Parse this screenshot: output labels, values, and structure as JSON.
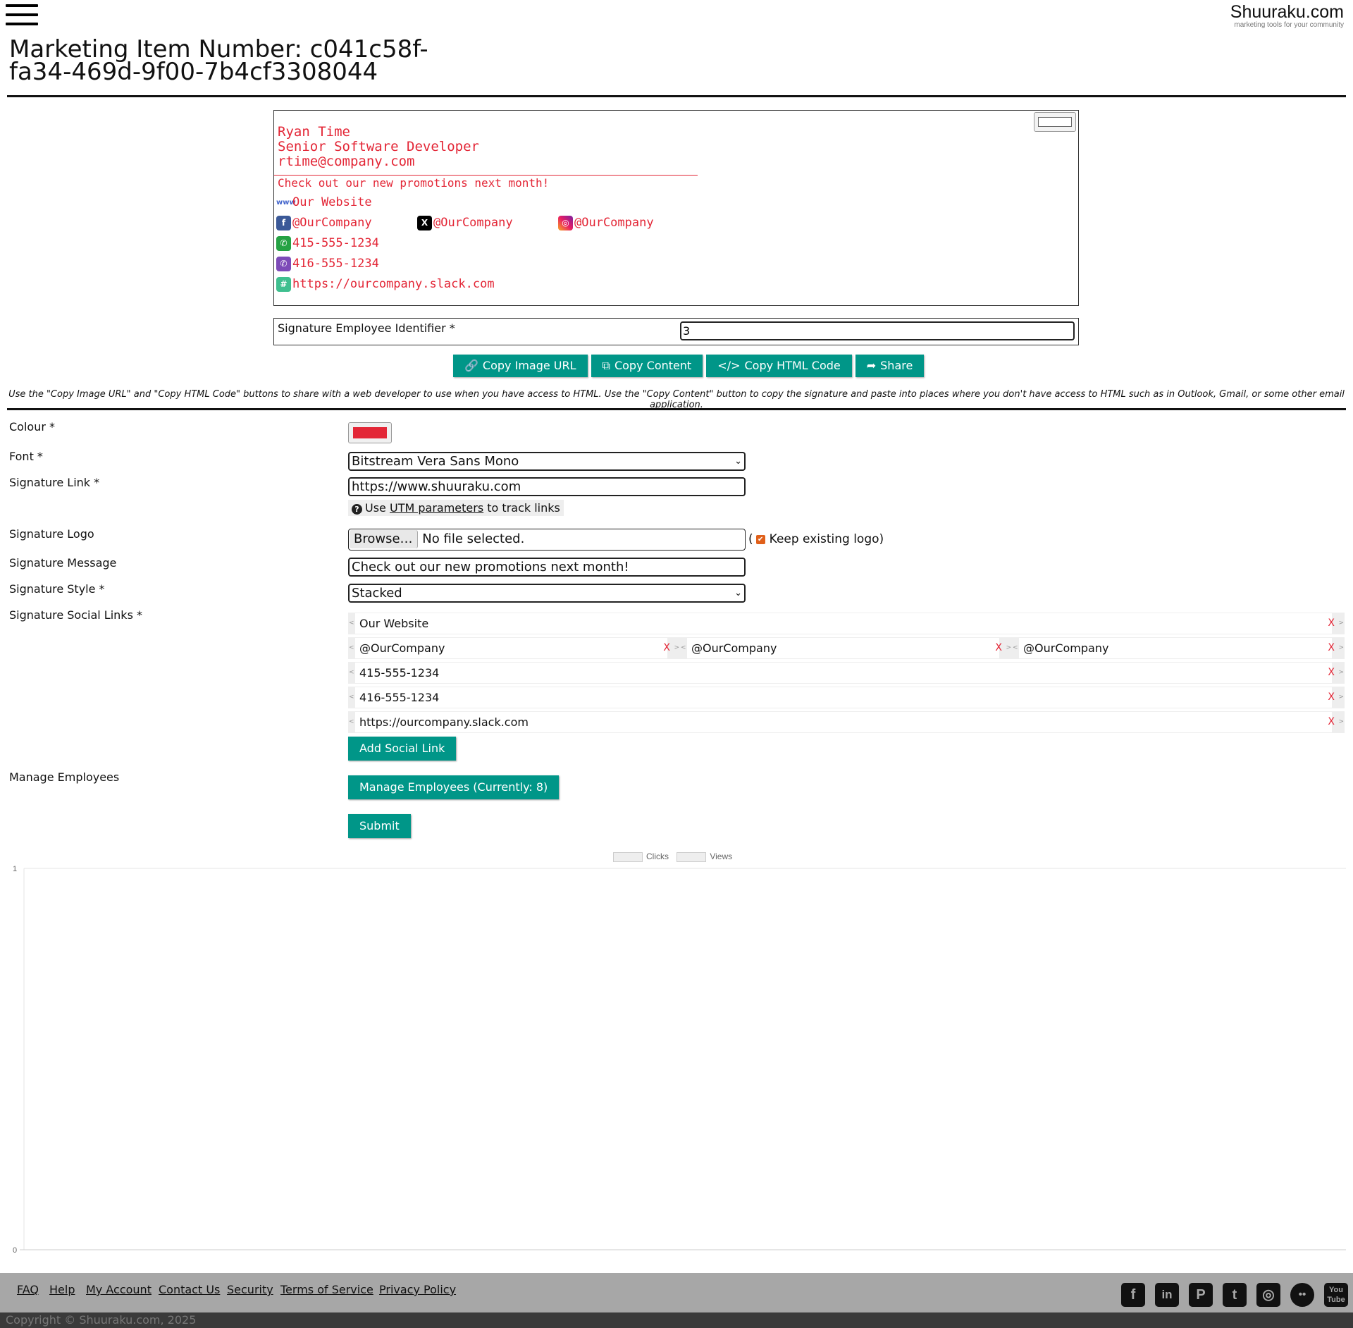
{
  "header": {
    "brand_name": "Shuuraku.com",
    "brand_tagline": "marketing tools for your community",
    "title": "Marketing Item Number: c041c58f-fa34-469d-9f00-7b4cf3308044"
  },
  "signature_preview": {
    "name": "Ryan Time",
    "job_title": "Senior Software Developer",
    "email": "rtime@company.com",
    "message": "Check out our new promotions next month!",
    "website": "Our Website",
    "facebook": "@OurCompany",
    "x": "@OurCompany",
    "instagram": "@OurCompany",
    "whatsapp": "415-555-1234",
    "viber": "416-555-1234",
    "slack": "https://ourcompany.slack.com",
    "color": "#e32636",
    "icons": {
      "www": "globe-icon",
      "facebook": "facebook-icon",
      "x": "x-icon",
      "instagram": "instagram-icon",
      "whatsapp": "whatsapp-icon",
      "viber": "viber-icon",
      "slack": "slack-icon"
    }
  },
  "identifier": {
    "label": "Signature Employee Identifier *",
    "value": "3"
  },
  "actions": {
    "copy_image_url": "Copy Image URL",
    "copy_content": "Copy Content",
    "copy_html_code": "Copy HTML Code",
    "share": "Share",
    "hint": "Use the \"Copy Image URL\" and \"Copy HTML Code\" buttons to share with a web developer to use when you have access to HTML. Use the \"Copy Content\" button to copy the signature and paste into places where you don't have access to HTML such as in Outlook, Gmail, or some other email application."
  },
  "form": {
    "colour_label": "Colour *",
    "colour_value": "#e32636",
    "font_label": "Font *",
    "font_value": "Bitstream Vera Sans Mono",
    "link_label": "Signature Link *",
    "link_value": "https://www.shuuraku.com",
    "utm_pre": "Use",
    "utm_link": "UTM parameters",
    "utm_post": "to track links",
    "logo_label": "Signature Logo",
    "browse": "Browse…",
    "no_file": "No file selected.",
    "keep_logo": "Keep existing logo)",
    "keep_open": "(",
    "message_label": "Signature Message",
    "message_value": "Check out our new promotions next month!",
    "style_label": "Signature Style *",
    "style_value": "Stacked",
    "social_label": "Signature Social Links *",
    "social_rows": [
      [
        "Our Website"
      ],
      [
        "@OurCompany",
        "@OurCompany",
        "@OurCompany"
      ],
      [
        "415-555-1234"
      ],
      [
        "416-555-1234"
      ],
      [
        "https://ourcompany.slack.com"
      ]
    ],
    "remove": "X",
    "add_social": "Add Social Link",
    "manage_label": "Manage Employees",
    "manage_button": "Manage Employees (Currently: 8)",
    "submit": "Submit"
  },
  "chart_data": {
    "type": "line",
    "series": [
      {
        "name": "Clicks",
        "values": []
      },
      {
        "name": "Views",
        "values": []
      }
    ],
    "ylim": [
      0,
      1
    ],
    "y_ticks": [
      "1",
      "0"
    ],
    "legend": "top-center",
    "grid": true
  },
  "footer": {
    "links": [
      "FAQ",
      "Help",
      "My Account",
      "Contact Us",
      "Security",
      "Terms of Service",
      "Privacy Policy"
    ],
    "social_icons": [
      "facebook-icon",
      "linkedin-icon",
      "pinterest-icon",
      "twitter-icon",
      "instagram-icon",
      "flickr-icon",
      "youtube-icon"
    ],
    "copyright": "Copyright © Shuuraku.com, 2025"
  }
}
